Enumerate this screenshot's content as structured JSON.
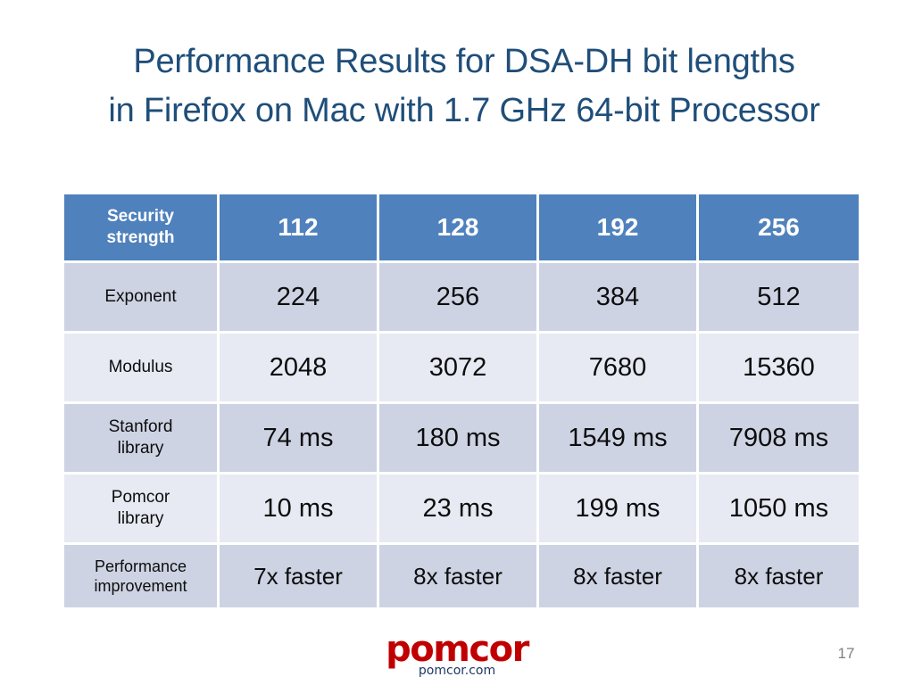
{
  "slide": {
    "title": "Performance Results for DSA-DH bit lengths\nin Firefox on Mac with 1.7 GHz 64-bit Processor",
    "page_number": "17",
    "title_color": "#1F4E79"
  },
  "logo": {
    "wordmark": "pomcor",
    "domain": "pomcor.com",
    "wordmark_color": "#C00000",
    "domain_color": "#1F3864"
  },
  "table": {
    "header_bg": "#4F81BD",
    "row_odd_bg": "#CDD3E3",
    "row_even_bg": "#E7EAF3",
    "header": {
      "label": "Security\nstrength",
      "values": [
        "112",
        "128",
        "192",
        "256"
      ]
    },
    "rows": [
      {
        "label": "Exponent",
        "values": [
          "224",
          "256",
          "384",
          "512"
        ]
      },
      {
        "label": "Modulus",
        "values": [
          "2048",
          "3072",
          "7680",
          "15360"
        ]
      },
      {
        "label": "Stanford\nlibrary",
        "values": [
          "74 ms",
          "180 ms",
          "1549 ms",
          "7908 ms"
        ]
      },
      {
        "label": "Pomcor\nlibrary",
        "values": [
          "10 ms",
          "23 ms",
          "199 ms",
          "1050 ms"
        ]
      },
      {
        "label": "Performance\nimprovement",
        "values": [
          "7x faster",
          "8x faster",
          "8x faster",
          "8x faster"
        ]
      }
    ]
  }
}
